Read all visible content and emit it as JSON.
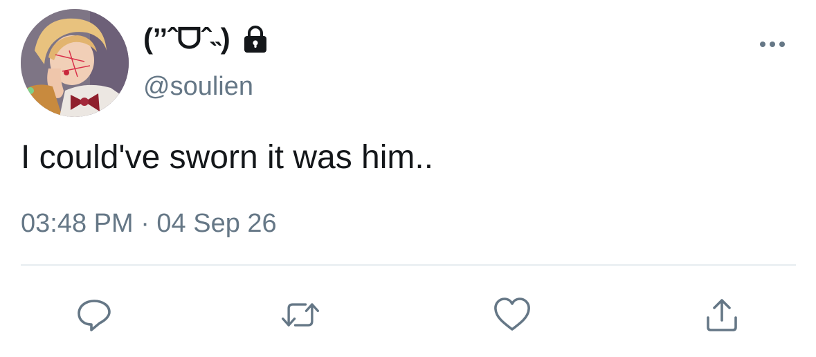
{
  "tweet": {
    "display_name": "(ˮˆᗜˆ˵)",
    "handle": "@soulien",
    "text": "I could've sworn it was him..",
    "timestamp": "03:48 PM · 04 Sep 26",
    "protected": true
  },
  "icons": {
    "protected": "lock-icon",
    "more": "more-options-icon",
    "reply": "reply-icon",
    "retweet": "retweet-icon",
    "like": "heart-icon",
    "share": "share-icon"
  },
  "colors": {
    "primary_text": "#14171a",
    "secondary_text": "#657786",
    "divider": "#e6ecf0",
    "icon": "#657786"
  }
}
